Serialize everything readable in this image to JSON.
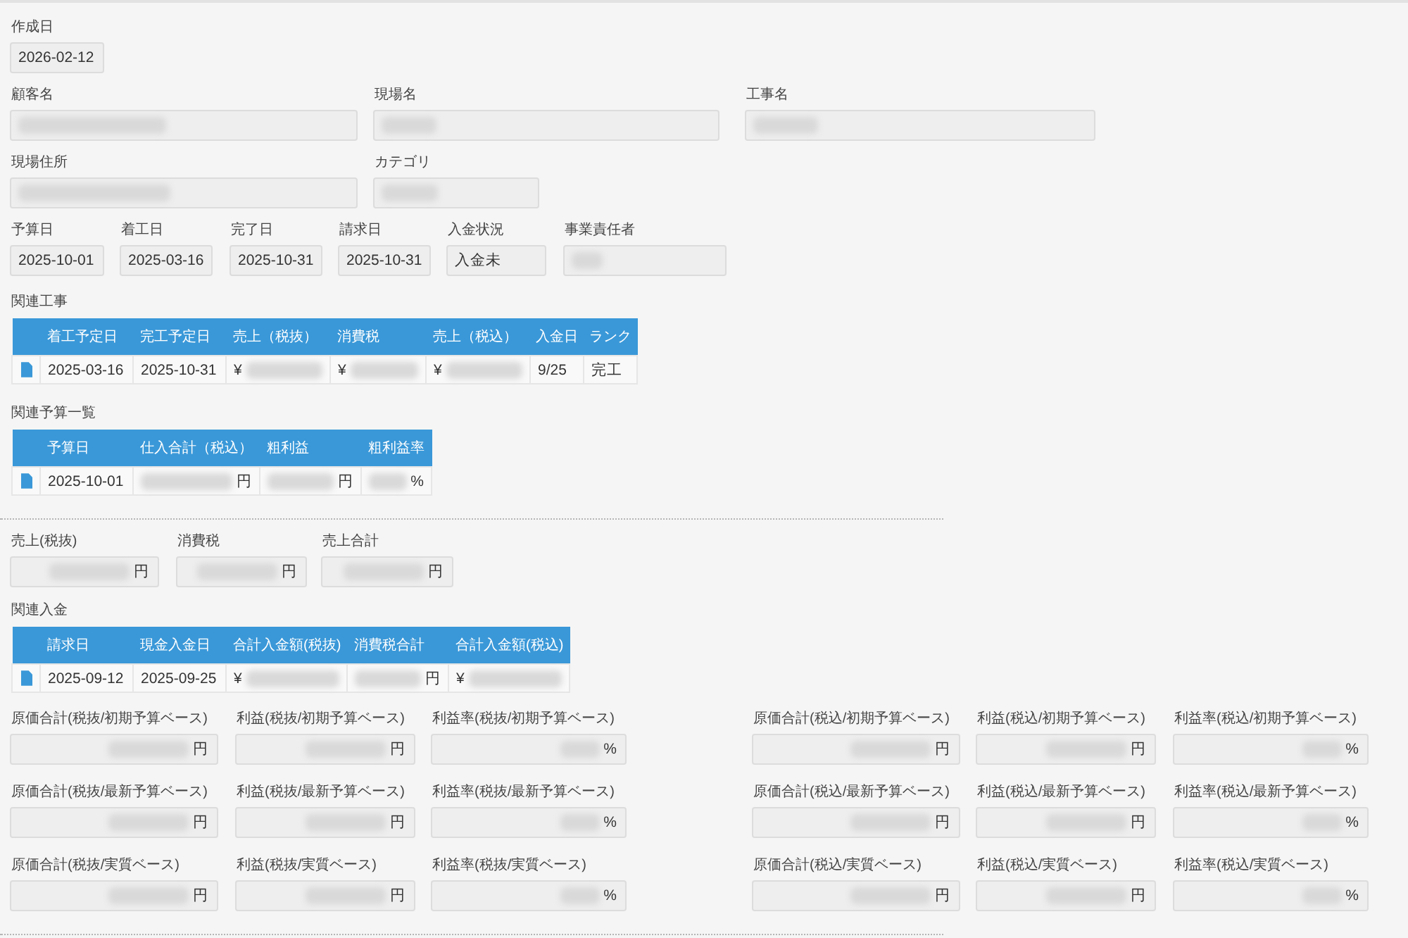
{
  "field_rows": [
    [
      {
        "label": "作成日",
        "value": "2026-02-12",
        "redacted": false
      }
    ],
    [
      {
        "label": "顧客名",
        "redacted": true
      },
      {
        "label": "現場名",
        "redacted": true
      },
      {
        "label": "工事名",
        "redacted": true
      }
    ],
    [
      {
        "label": "現場住所",
        "redacted": true
      },
      {
        "label": "カテゴリ",
        "redacted": true
      }
    ],
    [
      {
        "label": "予算日",
        "value": "2025-10-01",
        "redacted": false
      },
      {
        "label": "着工日",
        "value": "2025-03-16",
        "redacted": false
      },
      {
        "label": "完了日",
        "value": "2025-10-31",
        "redacted": false
      },
      {
        "label": "請求日",
        "value": "2025-10-31",
        "redacted": false
      },
      {
        "label": "入金状況",
        "value": "入金未",
        "redacted": false
      },
      {
        "label": "事業責任者",
        "redacted": true
      }
    ]
  ],
  "related_construction": {
    "title": "関連工事",
    "columns": [
      "着工予定日",
      "完工予定日",
      "売上（税抜）",
      "消費税",
      "売上（税込）",
      "入金日",
      "ランク"
    ],
    "rows": [
      {
        "cells": [
          {
            "value": "2025-03-16",
            "redacted": false
          },
          {
            "value": "2025-10-31",
            "redacted": false
          },
          {
            "prefix": "¥",
            "redacted": true
          },
          {
            "prefix": "¥",
            "redacted": true
          },
          {
            "prefix": "¥",
            "redacted": true
          },
          {
            "value": "9/25",
            "redacted": false
          },
          {
            "value": "完工",
            "redacted": false
          }
        ]
      }
    ]
  },
  "related_budgets": {
    "title": "関連予算一覧",
    "columns": [
      "予算日",
      "仕入合計（税込）",
      "粗利益",
      "粗利益率"
    ],
    "rows": [
      {
        "cells": [
          {
            "value": "2025-10-01",
            "redacted": false
          },
          {
            "unit": "円",
            "redacted": true
          },
          {
            "unit": "円",
            "redacted": true
          },
          {
            "unit": "%",
            "redacted": true
          }
        ]
      }
    ]
  },
  "sales_totals": [
    {
      "label": "売上(税抜)",
      "unit": "円",
      "redacted": true
    },
    {
      "label": "消費税",
      "unit": "円",
      "redacted": true
    },
    {
      "label": "売上合計",
      "unit": "円",
      "redacted": true
    }
  ],
  "related_payments": {
    "title": "関連入金",
    "columns": [
      "請求日",
      "現金入金日",
      "合計入金額(税抜)",
      "消費税合計",
      "合計入金額(税込)"
    ],
    "rows": [
      {
        "cells": [
          {
            "value": "2025-09-12",
            "redacted": false
          },
          {
            "value": "2025-09-25",
            "redacted": false
          },
          {
            "prefix": "¥",
            "redacted": true
          },
          {
            "unit": "円",
            "redacted": true
          },
          {
            "prefix": "¥",
            "redacted": true
          }
        ]
      }
    ]
  },
  "cost_profit_rows": [
    [
      {
        "label": "原価合計(税抜/初期予算ベース)",
        "unit": "円",
        "redacted": true
      },
      {
        "label": "利益(税抜/初期予算ベース)",
        "unit": "円",
        "redacted": true
      },
      {
        "label": "利益率(税抜/初期予算ベース)",
        "unit": "%",
        "redacted": true
      },
      {
        "label": "原価合計(税込/初期予算ベース)",
        "unit": "円",
        "redacted": true
      },
      {
        "label": "利益(税込/初期予算ベース)",
        "unit": "円",
        "redacted": true
      },
      {
        "label": "利益率(税込/初期予算ベース)",
        "unit": "%",
        "redacted": true
      }
    ],
    [
      {
        "label": "原価合計(税抜/最新予算ベース)",
        "unit": "円",
        "redacted": true
      },
      {
        "label": "利益(税抜/最新予算ベース)",
        "unit": "円",
        "redacted": true
      },
      {
        "label": "利益率(税抜/最新予算ベース)",
        "unit": "%",
        "redacted": true
      },
      {
        "label": "原価合計(税込/最新予算ベース)",
        "unit": "円",
        "redacted": true
      },
      {
        "label": "利益(税込/最新予算ベース)",
        "unit": "円",
        "redacted": true
      },
      {
        "label": "利益率(税込/最新予算ベース)",
        "unit": "%",
        "redacted": true
      }
    ],
    [
      {
        "label": "原価合計(税抜/実質ベース)",
        "unit": "円",
        "redacted": true
      },
      {
        "label": "利益(税抜/実質ベース)",
        "unit": "円",
        "redacted": true
      },
      {
        "label": "利益率(税抜/実質ベース)",
        "unit": "%",
        "redacted": true
      },
      {
        "label": "原価合計(税込/実質ベース)",
        "unit": "円",
        "redacted": true
      },
      {
        "label": "利益(税込/実質ベース)",
        "unit": "円",
        "redacted": true
      },
      {
        "label": "利益率(税込/実質ベース)",
        "unit": "%",
        "redacted": true
      }
    ]
  ]
}
